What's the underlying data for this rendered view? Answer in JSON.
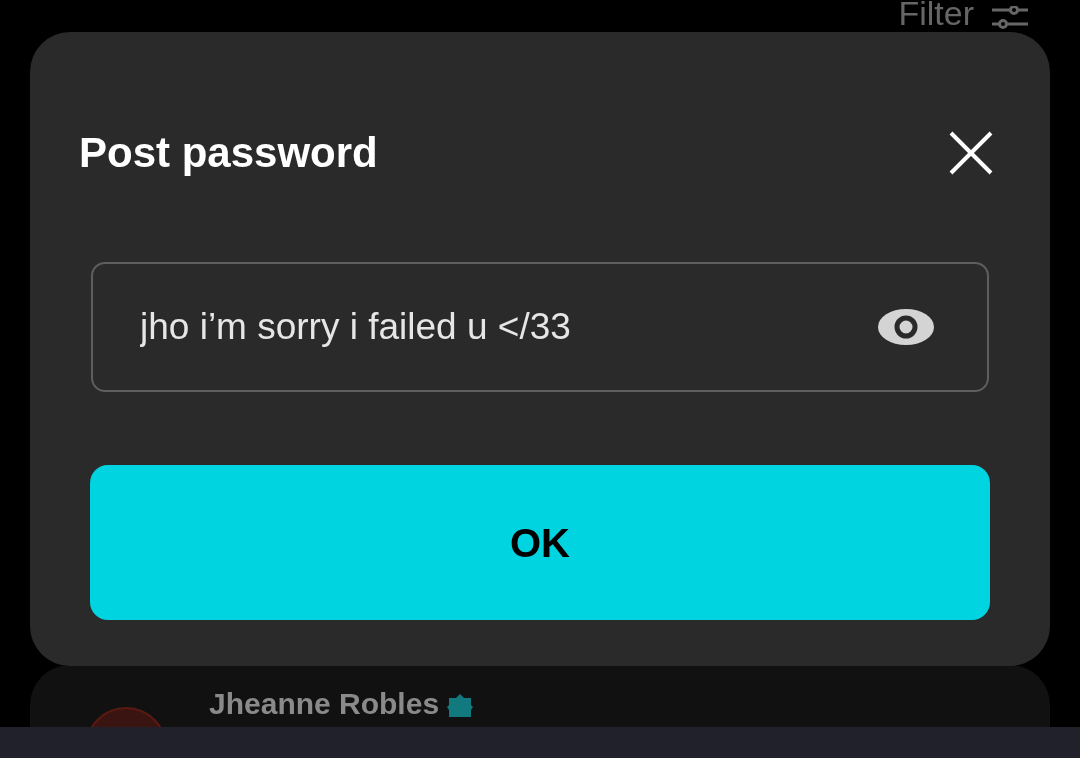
{
  "top_bar": {
    "filter_label": "Filter"
  },
  "dialog": {
    "title": "Post password",
    "field": {
      "value": "jho i’m sorry i failed u </33",
      "password_visible": true
    },
    "button": "OK"
  },
  "post": {
    "author": "Jheanne Robles",
    "verified": true
  }
}
